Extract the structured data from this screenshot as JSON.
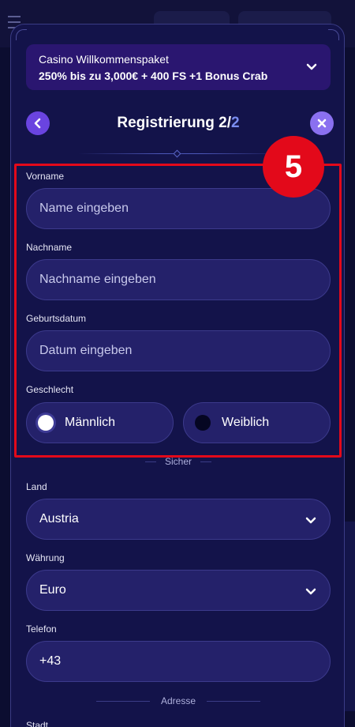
{
  "promo": {
    "line1": "Casino Willkommenspaket",
    "line2": "250% bis zu 3,000€ + 400 FS +1 Bonus Crab"
  },
  "header": {
    "title_prefix": "Registrierung 2/",
    "title_total": "2"
  },
  "form": {
    "first_name": {
      "label": "Vorname",
      "placeholder": "Name eingeben"
    },
    "last_name": {
      "label": "Nachname",
      "placeholder": "Nachname eingeben"
    },
    "birthdate": {
      "label": "Geburtsdatum",
      "placeholder": "Datum eingeben"
    },
    "gender": {
      "label": "Geschlecht",
      "options": [
        {
          "label": "Männlich",
          "selected": true
        },
        {
          "label": "Weiblich",
          "selected": false
        }
      ]
    },
    "section_secure": "Sicher",
    "country": {
      "label": "Land",
      "value": "Austria"
    },
    "currency": {
      "label": "Währung",
      "value": "Euro"
    },
    "phone": {
      "label": "Telefon",
      "value": "+43"
    },
    "section_address": "Adresse",
    "city": {
      "label": "Stadt"
    }
  },
  "annotation": {
    "step": "5"
  },
  "colors": {
    "accent": "#6a44e0",
    "highlight": "#e3091a",
    "field_bg": "#24216a"
  }
}
